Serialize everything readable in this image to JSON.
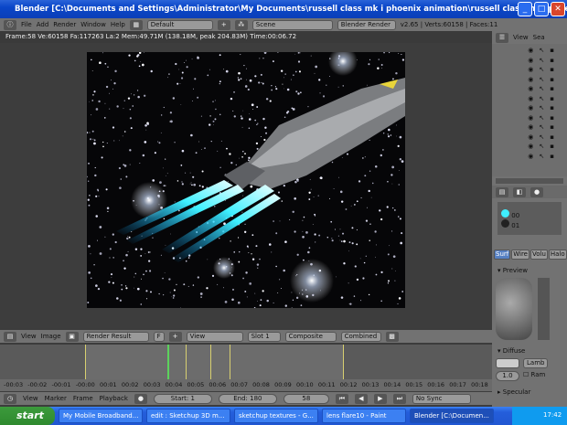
{
  "window": {
    "title": "Blender [C:\\Documents and Settings\\Administrator\\My Documents\\russell class mk i phoenix animation\\russell class mk i phoenix.blend]"
  },
  "menu": {
    "items": [
      "File",
      "Add",
      "Render",
      "Window",
      "Help"
    ],
    "layout": "Default",
    "scene": "Scene",
    "engine": "Blender Render",
    "stats": "v2.65 | Verts:60158 | Faces:11"
  },
  "info": "Frame:58 Ve:60158 Fa:117263 La:2 Mem:49.71M (138.18M, peak 204.83M) Time:00:06.72",
  "image_editor": {
    "menu": [
      "View",
      "Image"
    ],
    "image": "Render Result",
    "f": "F",
    "view": "View",
    "slot": "Slot 1",
    "composite": "Composite",
    "pass": "Combined"
  },
  "timeline": {
    "ticks": [
      "-00:03",
      "-00:02",
      "-00:01",
      "-00:00",
      "00:01",
      "00:02",
      "00:03",
      "00:04",
      "00:05",
      "00:06",
      "00:07",
      "00:08",
      "00:09",
      "00:10",
      "00:11",
      "00:12",
      "00:13",
      "00:14",
      "00:15",
      "00:16",
      "00:17",
      "00:18"
    ],
    "menu": [
      "View",
      "Marker",
      "Frame",
      "Playback"
    ],
    "start": "Start: 1",
    "end": "End: 180",
    "frame": "58",
    "sync": "No Sync"
  },
  "outliner": {
    "view": "View",
    "search": "Sea"
  },
  "properties": {
    "materials": [
      "00",
      "01"
    ],
    "tabs": [
      "Surf",
      "Wire",
      "Volu",
      "Halo"
    ],
    "preview": "Preview",
    "diffuse": "Diffuse",
    "shader": "Lamb",
    "intensity": "1.0",
    "ramp": "Ram",
    "specular": "Specular"
  },
  "taskbar": {
    "start": "start",
    "tasks": [
      "My Mobile Broadband...",
      "edit : Sketchup 3D m...",
      "sketchup textures - G...",
      "lens flare10 - Paint",
      "Blender [C:\\Documen..."
    ],
    "clock": "17:42"
  },
  "colors": {
    "accent": "#5680c2",
    "titlebar": "#0a46c8",
    "glow": "#3ff0ff"
  }
}
